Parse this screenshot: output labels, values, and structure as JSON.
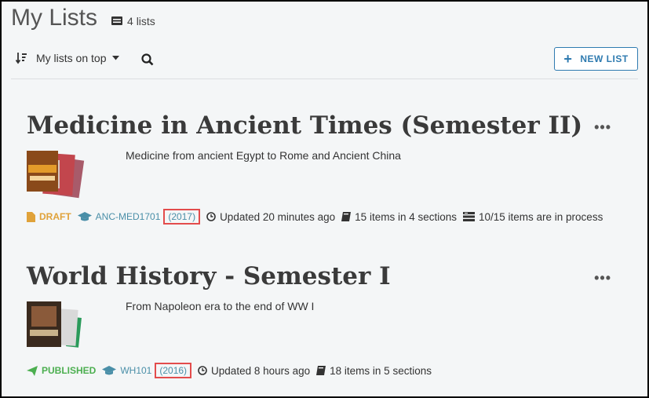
{
  "header": {
    "title": "My Lists",
    "count": "4 lists"
  },
  "toolbar": {
    "sort_label": "My lists on top",
    "new_list": "NEW LIST"
  },
  "lists": [
    {
      "title": "Medicine in Ancient Times (Semester II)",
      "description": "Medicine from ancient Egypt to Rome and Ancient China",
      "status": "DRAFT",
      "course": "ANC-MED1701",
      "year": "(2017)",
      "updated": "Updated 20 minutes ago",
      "items": "15 items in 4 sections",
      "process": "10/15 items are in process"
    },
    {
      "title": "World History - Semester I",
      "description": "From Napoleon era to the end of WW I",
      "status": "PUBLISHED",
      "course": "WH101",
      "year": "(2016)",
      "updated": "Updated 8 hours ago",
      "items": "18 items in 5 sections"
    }
  ],
  "colors": {
    "accent": "#2f7bb0",
    "draft": "#e0a23a",
    "published": "#4caf50",
    "highlight": "#e34c4c"
  }
}
